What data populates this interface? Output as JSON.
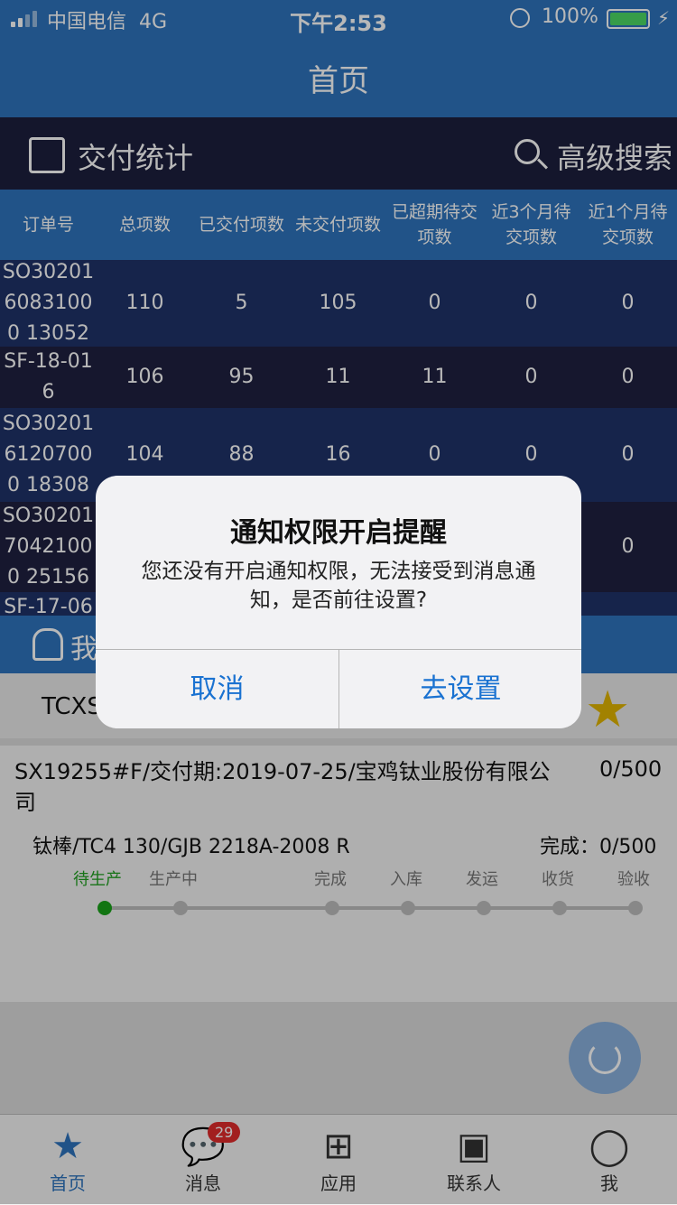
{
  "status": {
    "carrier": "中国电信",
    "network": "4G",
    "time": "下午2:53",
    "battery": "100%"
  },
  "nav": {
    "title": "首页"
  },
  "section": {
    "title": "交付统计",
    "search": "高级搜索"
  },
  "table": {
    "headers": [
      "订单号",
      "总项数",
      "已交付项数",
      "未交付项数",
      "已超期待交项数",
      "近3个月待交项数",
      "近1个月待交项数"
    ],
    "rows": [
      [
        "SO3020160831000 13052",
        "110",
        "5",
        "105",
        "0",
        "0",
        "0"
      ],
      [
        "SF-18-016",
        "106",
        "95",
        "11",
        "11",
        "0",
        "0"
      ],
      [
        "SO3020161207000 18308",
        "104",
        "88",
        "16",
        "0",
        "0",
        "0"
      ],
      [
        "SO3020170421000 25156",
        "",
        "",
        "",
        "",
        "",
        "0"
      ],
      [
        "SF-17-06",
        "",
        "",
        "",
        "",
        "",
        ""
      ]
    ]
  },
  "section2": {
    "title": "我"
  },
  "favorite": {
    "text": "TCXS"
  },
  "order": {
    "title": "SX19255#F/交付期:2019-07-25/宝鸡钛业股份有限公司",
    "qty": "0/500"
  },
  "item": {
    "name": "钛棒/TC4 130/GJB 2218A-2008 R",
    "done": "完成：0/500",
    "steps": [
      "待生产",
      "生产中",
      "完成",
      "入库",
      "发运",
      "收货",
      "验收"
    ],
    "current_step": 0
  },
  "tabs": [
    {
      "label": "首页",
      "icon": "star-icon"
    },
    {
      "label": "消息",
      "icon": "chat-icon",
      "badge": "29"
    },
    {
      "label": "应用",
      "icon": "apps-icon"
    },
    {
      "label": "联系人",
      "icon": "contacts-icon"
    },
    {
      "label": "我",
      "icon": "user-icon"
    }
  ],
  "dialog": {
    "title": "通知权限开启提醒",
    "message": "您还没有开启通知权限，无法接受到消息通知，是否前往设置?",
    "cancel": "取消",
    "confirm": "去设置"
  },
  "colors": {
    "brand": "#2f74bd",
    "header_dark": "#1c1f3e",
    "row_dark": "#1f2140",
    "row_mid": "#1f3268",
    "link": "#1a72d1"
  }
}
